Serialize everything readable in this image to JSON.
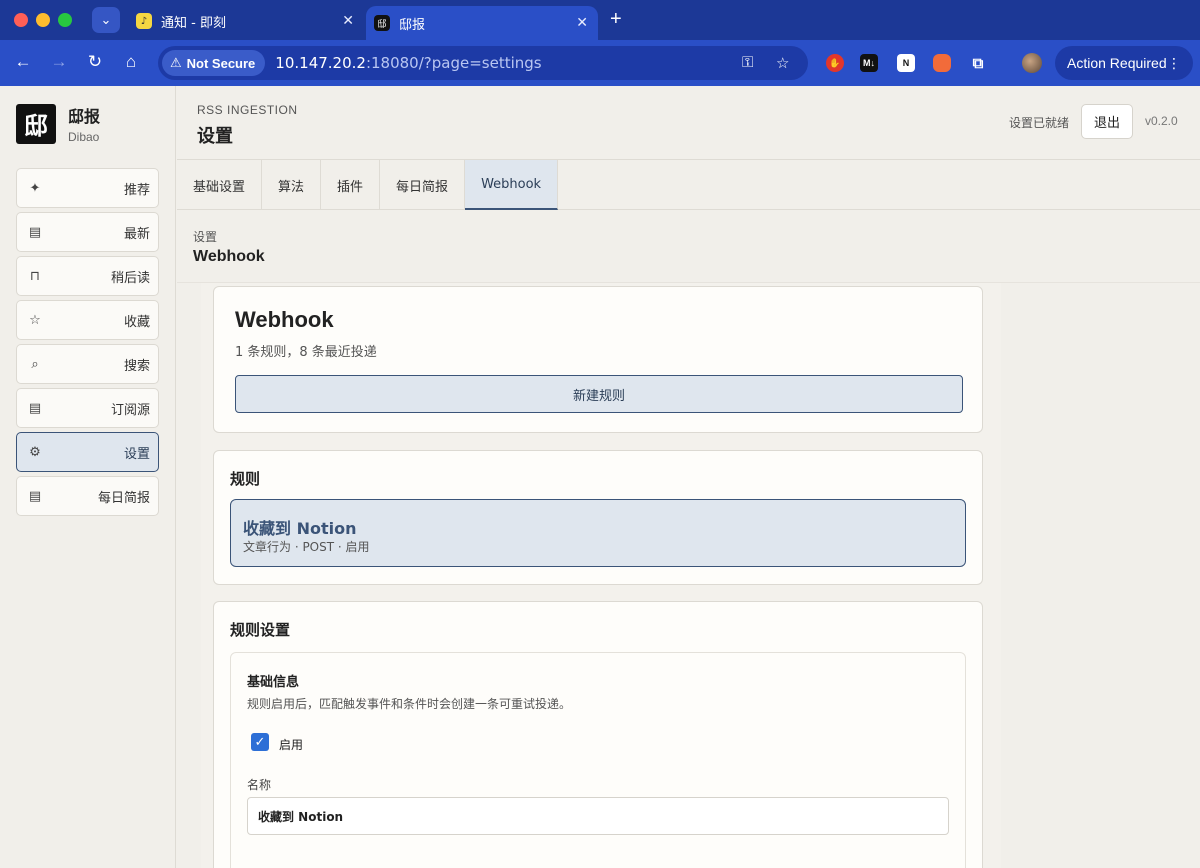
{
  "browser": {
    "tabs": [
      {
        "title": "通知 - 即刻"
      },
      {
        "title": "邸报"
      }
    ],
    "security_label": "Not Secure",
    "url_host": "10.147.20.2",
    "url_rest": ":18080/?page=settings",
    "action_required_label": "Action Required",
    "extensions": [
      "M↓",
      "N"
    ]
  },
  "brand": {
    "name": "邸报",
    "subtitle": "Dibao",
    "logo_glyph": "邸"
  },
  "sidebar": {
    "items": [
      {
        "label": "推荐",
        "icon": "sparkle-icon"
      },
      {
        "label": "最新",
        "icon": "document-icon"
      },
      {
        "label": "稍后读",
        "icon": "bookmark-icon"
      },
      {
        "label": "收藏",
        "icon": "star-icon"
      },
      {
        "label": "搜索",
        "icon": "search-icon"
      },
      {
        "label": "订阅源",
        "icon": "document-icon"
      },
      {
        "label": "设置",
        "icon": "gear-icon",
        "active": true
      },
      {
        "label": "每日简报",
        "icon": "document-icon"
      }
    ]
  },
  "header": {
    "eyebrow": "RSS INGESTION",
    "title": "设置",
    "status": "设置已就绪",
    "logout_label": "退出",
    "version": "v0.2.0"
  },
  "tabs": [
    {
      "label": "基础设置"
    },
    {
      "label": "算法"
    },
    {
      "label": "插件"
    },
    {
      "label": "每日简报"
    },
    {
      "label": "Webhook",
      "active": true
    }
  ],
  "section": {
    "eyebrow": "设置",
    "title": "Webhook"
  },
  "webhook_card": {
    "title": "Webhook",
    "summary": "1 条规则，8 条最近投递",
    "new_rule_label": "新建规则"
  },
  "rules_card": {
    "title": "规则",
    "rules": [
      {
        "name": "收藏到 Notion",
        "meta": "文章行为 · POST · 启用"
      }
    ]
  },
  "rule_settings": {
    "title": "规则设置",
    "basic": {
      "title": "基础信息",
      "description": "规则启用后，匹配触发事件和条件时会创建一条可重试投递。",
      "enabled_label": "启用",
      "enabled": true,
      "name_label": "名称",
      "name_value": "收藏到 Notion"
    }
  },
  "colors": {
    "accent": "#3b5478",
    "accent_bg": "#dfe6ee",
    "checkbox": "#2d6fd6",
    "browser": "#2a4fc7"
  }
}
